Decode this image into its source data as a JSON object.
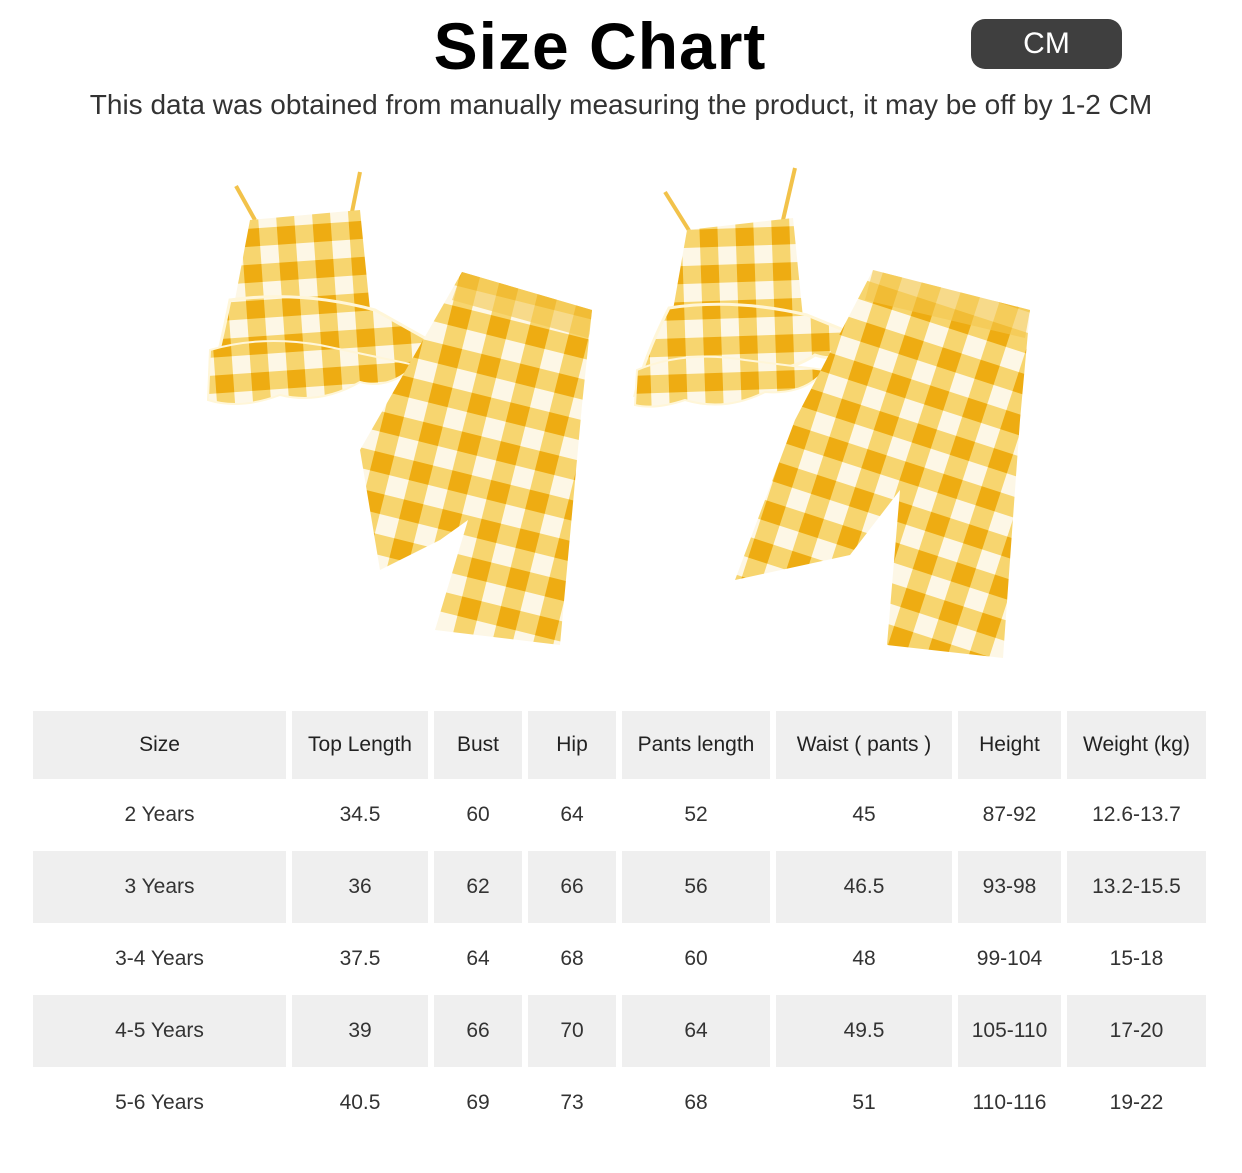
{
  "header": {
    "title": "Size Chart",
    "unit": "CM",
    "note": "This data was obtained from manually measuring the product, it may be off by 1-2 CM"
  },
  "colors": {
    "gingham_yellow": "#f2b71f",
    "gingham_light": "#f8dc8a",
    "pill_bg": "#3f3f3f",
    "row_shade": "#efefef"
  },
  "table": {
    "headers": [
      "Size",
      "Top Length",
      "Bust",
      "Hip",
      "Pants length",
      "Waist ( pants )",
      "Height",
      "Weight (kg)"
    ],
    "rows": [
      [
        "2 Years",
        "34.5",
        "60",
        "64",
        "52",
        "45",
        "87-92",
        "12.6-13.7"
      ],
      [
        "3 Years",
        "36",
        "62",
        "66",
        "56",
        "46.5",
        "93-98",
        "13.2-15.5"
      ],
      [
        "3-4 Years",
        "37.5",
        "64",
        "68",
        "60",
        "48",
        "99-104",
        "15-18"
      ],
      [
        "4-5 Years",
        "39",
        "66",
        "70",
        "64",
        "49.5",
        "105-110",
        "17-20"
      ],
      [
        "5-6 Years",
        "40.5",
        "69",
        "73",
        "68",
        "51",
        "110-116",
        "19-22"
      ]
    ]
  }
}
